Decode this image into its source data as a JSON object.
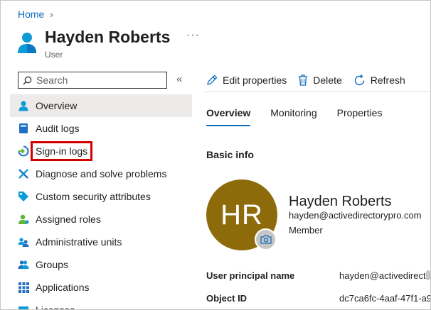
{
  "breadcrumb": {
    "home": "Home",
    "separator": "›"
  },
  "header": {
    "title": "Hayden Roberts",
    "subtitle": "User",
    "more": "···"
  },
  "search": {
    "placeholder": "Search",
    "collapse": "«"
  },
  "nav": {
    "items": [
      {
        "label": "Overview",
        "icon": "user-icon"
      },
      {
        "label": "Audit logs",
        "icon": "book-icon"
      },
      {
        "label": "Sign-in logs",
        "icon": "sign-in-icon"
      },
      {
        "label": "Diagnose and solve problems",
        "icon": "wrench-icon"
      },
      {
        "label": "Custom security attributes",
        "icon": "tag-icon"
      },
      {
        "label": "Assigned roles",
        "icon": "roles-icon"
      },
      {
        "label": "Administrative units",
        "icon": "admin-units-icon"
      },
      {
        "label": "Groups",
        "icon": "groups-icon"
      },
      {
        "label": "Applications",
        "icon": "grid-icon"
      },
      {
        "label": "Licenses",
        "icon": "license-icon"
      }
    ]
  },
  "toolbar": {
    "edit": "Edit properties",
    "delete": "Delete",
    "refresh": "Refresh"
  },
  "tabs": [
    {
      "label": "Overview"
    },
    {
      "label": "Monitoring"
    },
    {
      "label": "Properties"
    }
  ],
  "basic_info": {
    "heading": "Basic info",
    "initials": "HR",
    "name": "Hayden Roberts",
    "email": "hayden@activedirectorypro.com",
    "role": "Member"
  },
  "properties": [
    {
      "label": "User principal name",
      "value": "hayden@activedirectorypro.com"
    },
    {
      "label": "Object ID",
      "value": "dc7ca6fc-4aaf-47f1-a9"
    }
  ],
  "colors": {
    "accent": "#0f6cbd",
    "highlight": "#d40000",
    "avatar": "#8e6b0a"
  }
}
